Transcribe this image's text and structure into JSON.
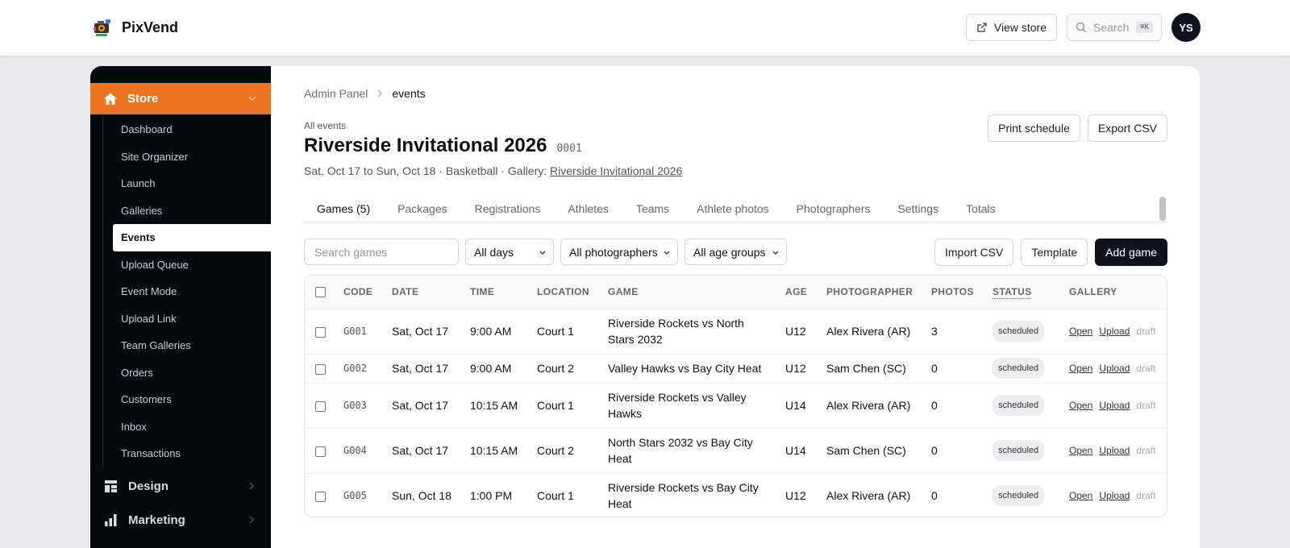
{
  "app": {
    "name": "PixVend"
  },
  "topbar": {
    "view_store": "View store",
    "search_placeholder": "Search",
    "search_kbd": "⌘K",
    "avatar": "YS"
  },
  "sidebar": {
    "store_label": "Store",
    "items": [
      "Dashboard",
      "Site Organizer",
      "Launch",
      "Galleries",
      "Events",
      "Upload Queue",
      "Event Mode",
      "Upload Link",
      "Team Galleries",
      "Orders",
      "Customers",
      "Inbox",
      "Transactions"
    ],
    "active_item": "Events",
    "sections": [
      "Design",
      "Marketing"
    ]
  },
  "breadcrumb": {
    "root": "Admin Panel",
    "current": "events"
  },
  "event": {
    "back_label": "All events",
    "title": "Riverside Invitational 2026",
    "code": "0001",
    "meta_prefix": "Sat, Oct 17 to Sun, Oct 18 · Basketball · Gallery: ",
    "gallery_link": "Riverside Invitational 2026"
  },
  "header_buttons": {
    "print": "Print schedule",
    "export": "Export CSV"
  },
  "tabs": [
    "Games (5)",
    "Packages",
    "Registrations",
    "Athletes",
    "Teams",
    "Athlete photos",
    "Photographers",
    "Settings",
    "Totals"
  ],
  "toolbar": {
    "search_placeholder": "Search games",
    "days": "All days",
    "photographers": "All photographers",
    "age_groups": "All age groups",
    "import": "Import CSV",
    "template": "Template",
    "add": "Add game"
  },
  "table": {
    "columns": [
      "CODE",
      "DATE",
      "TIME",
      "LOCATION",
      "GAME",
      "AGE",
      "PHOTOGRAPHER",
      "PHOTOS",
      "STATUS",
      "GALLERY"
    ],
    "gallery_links": {
      "open": "Open",
      "upload": "Upload",
      "draft": "draft"
    },
    "rows": [
      {
        "code": "G001",
        "date": "Sat, Oct 17",
        "time": "9:00 AM",
        "location": "Court 1",
        "game": "Riverside Rockets vs North Stars 2032",
        "age": "U12",
        "photographer": "Alex Rivera (AR)",
        "photos": "3",
        "status": "scheduled"
      },
      {
        "code": "G002",
        "date": "Sat, Oct 17",
        "time": "9:00 AM",
        "location": "Court 2",
        "game": "Valley Hawks vs Bay City Heat",
        "age": "U12",
        "photographer": "Sam Chen (SC)",
        "photos": "0",
        "status": "scheduled"
      },
      {
        "code": "G003",
        "date": "Sat, Oct 17",
        "time": "10:15 AM",
        "location": "Court 1",
        "game": "Riverside Rockets vs Valley Hawks",
        "age": "U14",
        "photographer": "Alex Rivera (AR)",
        "photos": "0",
        "status": "scheduled"
      },
      {
        "code": "G004",
        "date": "Sat, Oct 17",
        "time": "10:15 AM",
        "location": "Court 2",
        "game": "North Stars 2032 vs Bay City Heat",
        "age": "U14",
        "photographer": "Sam Chen (SC)",
        "photos": "0",
        "status": "scheduled"
      },
      {
        "code": "G005",
        "date": "Sun, Oct 18",
        "time": "1:00 PM",
        "location": "Court 1",
        "game": "Riverside Rockets vs Bay City Heat",
        "age": "U12",
        "photographer": "Alex Rivera (AR)",
        "photos": "0",
        "status": "scheduled"
      }
    ]
  },
  "colors": {
    "accent": "#ea7420",
    "sidebar_bg": "#04080f",
    "dark_button": "#0d1420"
  }
}
